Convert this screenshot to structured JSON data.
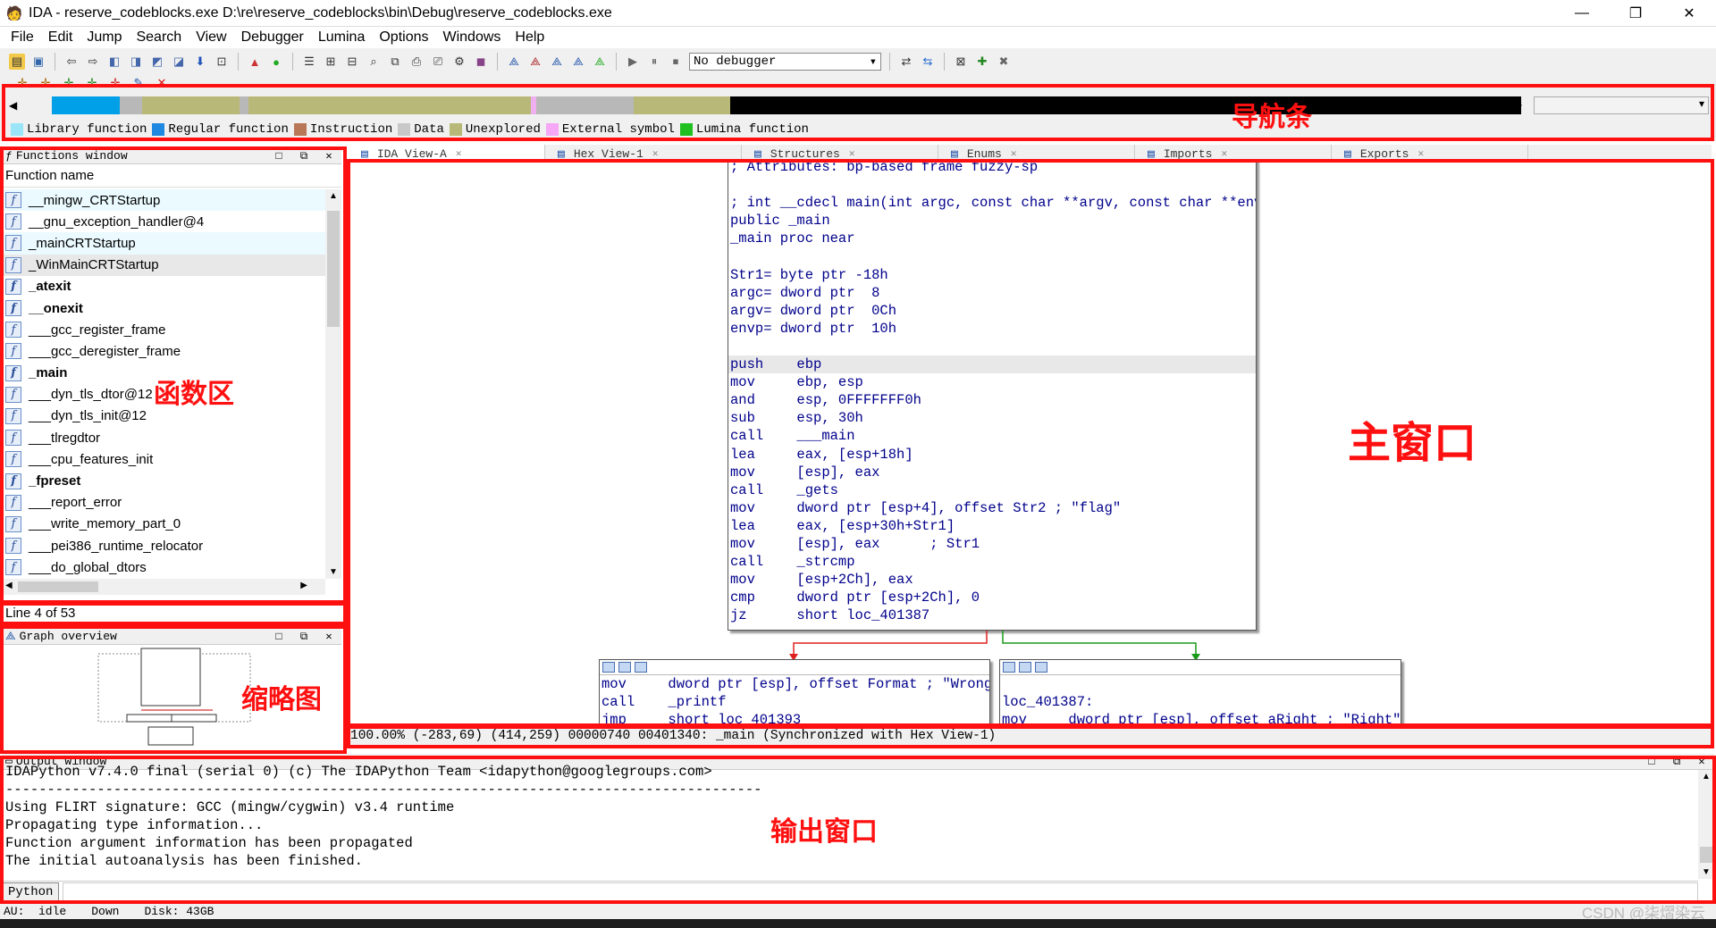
{
  "window": {
    "title": "IDA - reserve_codeblocks.exe D:\\re\\reserve_codeblocks\\bin\\Debug\\reserve_codeblocks.exe",
    "minimize": "—",
    "restore": "❐",
    "close": "✕"
  },
  "menu": [
    "File",
    "Edit",
    "Jump",
    "Search",
    "View",
    "Debugger",
    "Lumina",
    "Options",
    "Windows",
    "Help"
  ],
  "toolbar": {
    "debugger_select": "No debugger"
  },
  "navigation": {
    "segments": [
      {
        "color": "#f0f0f0",
        "frac": 0.012
      },
      {
        "color": "#00a0e8",
        "frac": 0.046
      },
      {
        "color": "#b8b8b8",
        "frac": 0.015
      },
      {
        "color": "#b8b878",
        "frac": 0.065
      },
      {
        "color": "#b8b8b8",
        "frac": 0.006
      },
      {
        "color": "#b8b878",
        "frac": 0.058
      },
      {
        "color": "#b8b878",
        "frac": 0.067
      },
      {
        "color": "#b8b878",
        "frac": 0.065
      },
      {
        "color": "#f0b0f0",
        "frac": 0.004
      },
      {
        "color": "#b8b8b8",
        "frac": 0.065
      },
      {
        "color": "#b8b878",
        "frac": 0.065
      },
      {
        "color": "#000000",
        "frac": 0.532
      }
    ],
    "legend": [
      {
        "label": "Library function",
        "color": "#9ae6f8"
      },
      {
        "label": "Regular function",
        "color": "#1f88e0"
      },
      {
        "label": "Instruction",
        "color": "#b87858"
      },
      {
        "label": "Data",
        "color": "#c8c8c8"
      },
      {
        "label": "Unexplored",
        "color": "#b8b878"
      },
      {
        "label": "External symbol",
        "color": "#f6a8f6"
      },
      {
        "label": "Lumina function",
        "color": "#20c020"
      }
    ]
  },
  "annotations": {
    "nav": "导航条",
    "functions": "函数区",
    "main": "主窗口",
    "overview": "缩略图",
    "output": "输出窗口"
  },
  "functions_window": {
    "title": "Functions window",
    "column": "Function name",
    "items": [
      {
        "name": "__mingw_CRTStartup",
        "style": "lib"
      },
      {
        "name": "__gnu_exception_handler@4",
        "style": ""
      },
      {
        "name": "_mainCRTStartup",
        "style": "lib"
      },
      {
        "name": "_WinMainCRTStartup",
        "style": "sel"
      },
      {
        "name": "_atexit",
        "style": "b"
      },
      {
        "name": "__onexit",
        "style": "b"
      },
      {
        "name": "___gcc_register_frame",
        "style": ""
      },
      {
        "name": "___gcc_deregister_frame",
        "style": ""
      },
      {
        "name": "_main",
        "style": "b"
      },
      {
        "name": "___dyn_tls_dtor@12",
        "style": ""
      },
      {
        "name": "___dyn_tls_init@12",
        "style": ""
      },
      {
        "name": "___tlregdtor",
        "style": ""
      },
      {
        "name": "___cpu_features_init",
        "style": ""
      },
      {
        "name": "_fpreset",
        "style": "b"
      },
      {
        "name": "___report_error",
        "style": ""
      },
      {
        "name": "___write_memory_part_0",
        "style": ""
      },
      {
        "name": "___pei386_runtime_relocator",
        "style": ""
      },
      {
        "name": "___do_global_dtors",
        "style": ""
      }
    ],
    "line_info": "Line 4 of 53"
  },
  "graph_overview": {
    "title": "Graph overview"
  },
  "tabs": [
    {
      "label": "IDA View-A",
      "active": true
    },
    {
      "label": "Hex View-1",
      "active": false
    },
    {
      "label": "Structures",
      "active": false
    },
    {
      "label": "Enums",
      "active": false
    },
    {
      "label": "Imports",
      "active": false
    },
    {
      "label": "Exports",
      "active": false
    }
  ],
  "graph": {
    "main_block": [
      {
        "t": "; Attributes: bp-based frame fuzzy-sp",
        "c": "cmt"
      },
      {
        "t": "",
        "c": ""
      },
      {
        "t": "; int __cdecl main(int argc, const char **argv, const char **envp)",
        "c": "kw"
      },
      {
        "t": "public _main",
        "c": "kw"
      },
      {
        "t": "_main proc near",
        "c": "kw"
      },
      {
        "t": "",
        "c": ""
      },
      {
        "t": "Str1= byte ptr -18h",
        "c": "var"
      },
      {
        "t": "argc= dword ptr  8",
        "c": "var"
      },
      {
        "t": "argv= dword ptr  0Ch",
        "c": "var"
      },
      {
        "t": "envp= dword ptr  10h",
        "c": "var"
      },
      {
        "t": "",
        "c": ""
      },
      {
        "t": "push    ebp",
        "c": "hl"
      },
      {
        "t": "mov     ebp, esp",
        "c": ""
      },
      {
        "t": "and     esp, 0FFFFFFF0h",
        "c": ""
      },
      {
        "t": "sub     esp, 30h",
        "c": ""
      },
      {
        "t": "call    ___main",
        "c": ""
      },
      {
        "t": "lea     eax, [esp+18h]",
        "c": ""
      },
      {
        "t": "mov     [esp], eax",
        "c": ""
      },
      {
        "t": "call    _gets",
        "c": ""
      },
      {
        "t": "mov     dword ptr [esp+4], offset Str2 ; \"flag\"",
        "c": ""
      },
      {
        "t": "lea     eax, [esp+30h+Str1]",
        "c": ""
      },
      {
        "t": "mov     [esp], eax      ; Str1",
        "c": ""
      },
      {
        "t": "call    _strcmp",
        "c": ""
      },
      {
        "t": "mov     [esp+2Ch], eax",
        "c": ""
      },
      {
        "t": "cmp     dword ptr [esp+2Ch], 0",
        "c": ""
      },
      {
        "t": "jz      short loc_401387",
        "c": ""
      }
    ],
    "left_block": [
      {
        "t": "mov     dword ptr [esp], offset Format ; \"Wrong\"",
        "c": ""
      },
      {
        "t": "call    _printf",
        "c": ""
      },
      {
        "t": "jmp     short loc_401393",
        "c": ""
      }
    ],
    "right_block": [
      {
        "t": "",
        "c": ""
      },
      {
        "t": "loc_401387:",
        "c": ""
      },
      {
        "t": "mov     dword ptr [esp], offset aRight ; \"Right\"",
        "c": ""
      }
    ]
  },
  "status_line": "100.00% (-283,69) (414,259) 00000740 00401340: _main (Synchronized with Hex View-1)",
  "output_window": {
    "title": "Output window",
    "lines": [
      "IDAPython v7.4.0 final (serial 0) (c) The IDAPython Team <idapython@googlegroups.com>",
      "-------------------------------------------------------------------------------------------",
      "Using FLIRT signature: GCC (mingw/cygwin) v3.4 runtime",
      "Propagating type information...",
      "Function argument information has been propagated",
      "The initial autoanalysis has been finished."
    ],
    "python_button": "Python"
  },
  "statusbar": {
    "au": "AU:  idle",
    "dir": "Down",
    "disk": "Disk: 43GB"
  },
  "watermark": "CSDN @柒熠染云"
}
